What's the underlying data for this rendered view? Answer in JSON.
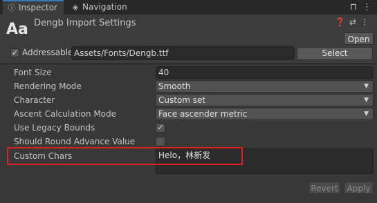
{
  "tabs": [
    {
      "label": "Inspector",
      "icon": "info-icon"
    },
    {
      "label": "Navigation",
      "icon": "navigation-icon"
    }
  ],
  "tab_icons": {
    "menu": "⋮",
    "lock": "🔒"
  },
  "header": {
    "badge": "Aa",
    "title": "Dengb Import Settings",
    "open_label": "Open",
    "addressable_label": "Addressable",
    "addressable_checked": true,
    "path": "Assets/Fonts/Dengb.ttf",
    "select_label": "Select"
  },
  "properties": {
    "font_size": {
      "label": "Font Size",
      "value": "40"
    },
    "rendering_mode": {
      "label": "Rendering Mode",
      "value": "Smooth"
    },
    "character": {
      "label": "Character",
      "value": "Custom set"
    },
    "ascent_mode": {
      "label": "Ascent Calculation Mode",
      "value": "Face ascender metric"
    },
    "legacy_bounds": {
      "label": "Use Legacy Bounds",
      "checked": true
    },
    "round_advance": {
      "label": "Should Round Advance Value",
      "checked": false
    },
    "custom_chars": {
      "label": "Custom Chars",
      "value": "Helo，林新发"
    }
  },
  "footer": {
    "revert_label": "Revert",
    "apply_label": "Apply"
  },
  "colors": {
    "highlight": "#e02020",
    "active_tab_accent": "#3a79bb"
  }
}
